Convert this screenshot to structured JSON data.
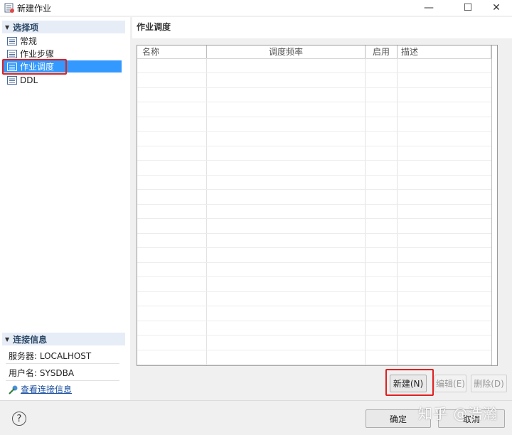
{
  "window": {
    "title": "新建作业"
  },
  "sidebar": {
    "options_header": "选择项",
    "items": [
      {
        "label": "常规"
      },
      {
        "label": "作业步骤"
      },
      {
        "label": "作业调度",
        "selected": true
      },
      {
        "label": "DDL"
      }
    ],
    "connection_header": "连接信息",
    "server_label": "服务器: LOCALHOST",
    "user_label": "用户名: SYSDBA",
    "view_connection_link": "查看连接信息"
  },
  "main": {
    "title": "作业调度",
    "table": {
      "columns": [
        "名称",
        "调度频率",
        "启用",
        "描述"
      ],
      "rows": []
    },
    "buttons": {
      "new": "新建(N)",
      "edit": "编辑(E)",
      "delete": "删除(D)"
    }
  },
  "footer": {
    "ok": "确定",
    "cancel": "取消"
  },
  "watermark": "知乎 @浩瀚",
  "colors": {
    "selection": "#3399ff",
    "highlight_box": "#e02020",
    "section_header_bg": "#e6edf6"
  }
}
